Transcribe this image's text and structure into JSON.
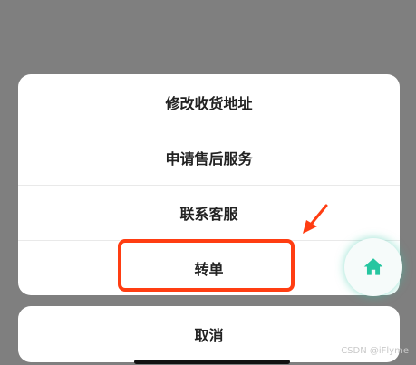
{
  "action_sheet": {
    "items": [
      {
        "label": "修改收货地址"
      },
      {
        "label": "申请售后服务"
      },
      {
        "label": "联系客服"
      },
      {
        "label": "转单"
      }
    ],
    "cancel_label": "取消"
  },
  "home_button": {
    "icon": "home-icon",
    "color": "#26c6a0"
  },
  "annotation": {
    "color": "#ff3d12"
  },
  "watermark": "CSDN @iFlyme"
}
